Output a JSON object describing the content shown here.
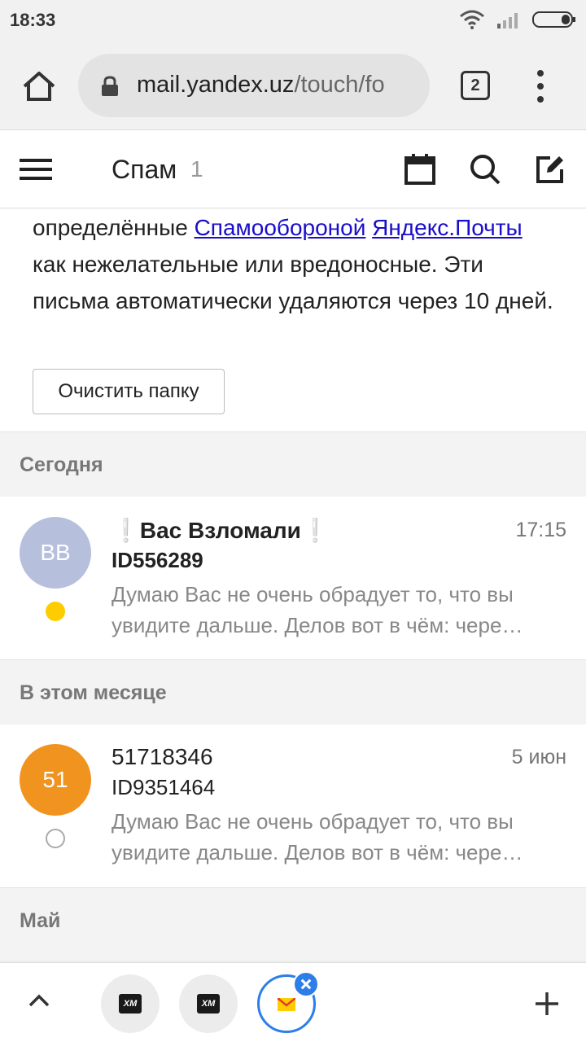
{
  "status_bar": {
    "time": "18:33"
  },
  "browser": {
    "url_host": "mail.yandex.uz",
    "url_path": "/touch/fo",
    "tab_count": "2"
  },
  "header": {
    "title": "Спам",
    "count": "1"
  },
  "info": {
    "text_1": "определённые ",
    "link_1": "Спамообороной",
    "link_2": "Яндекс.Почты",
    "text_2": " как нежелательные или вредоносные. Эти письма автоматически удаляются через 10 дней.",
    "clear_button": "Очистить папку"
  },
  "sections": {
    "today": "Сегодня",
    "this_month": "В этом месяце",
    "may": "Май"
  },
  "messages": [
    {
      "avatar_text": "ВВ",
      "avatar_color": "#b6bfdc",
      "unread_color": "#ffcc00",
      "from": "Вас Взломали",
      "excl": "❕",
      "time": "17:15",
      "subject": "ID556289",
      "snippet": "Думаю Вас не очень обрадует то, что вы увидите дальше. Делов вот в чём: чере…"
    },
    {
      "avatar_text": "51",
      "avatar_color": "#f0941f",
      "from": "51718346",
      "time": "5 июн",
      "subject": "ID9351464",
      "snippet": "Думаю Вас не очень обрадует то, что вы увидите дальше. Делов вот в чём: чере…"
    }
  ],
  "bottom": {
    "xm_label": "XM"
  },
  "colors": {
    "accent": "#2d7ee8",
    "link": "#1a0dcc",
    "excl": "#3aa7e6"
  }
}
